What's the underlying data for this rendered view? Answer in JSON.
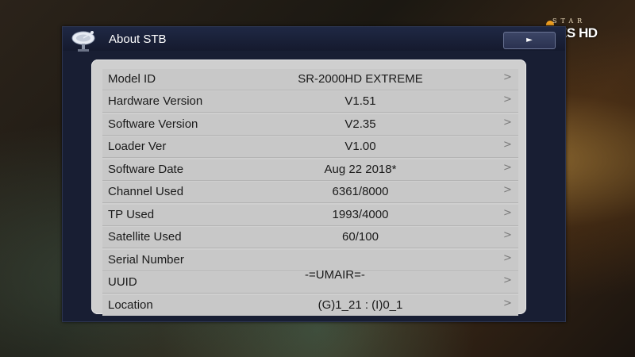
{
  "logo": {
    "star": "STAR",
    "name": "VIES HD"
  },
  "window": {
    "title": "About STB",
    "play_button": "►",
    "watermark": "-=UMAIR=-"
  },
  "rows": [
    {
      "label": "Model ID",
      "value": "SR-2000HD EXTREME",
      "arrow": ">"
    },
    {
      "label": "Hardware Version",
      "value": "V1.51",
      "arrow": ">"
    },
    {
      "label": "Software Version",
      "value": "V2.35",
      "arrow": ">"
    },
    {
      "label": "Loader Ver",
      "value": "V1.00",
      "arrow": ">"
    },
    {
      "label": "Software Date",
      "value": "Aug 22 2018*",
      "arrow": ">"
    },
    {
      "label": "Channel Used",
      "value": "6361/8000",
      "arrow": ">"
    },
    {
      "label": "TP Used",
      "value": "1993/4000",
      "arrow": ">"
    },
    {
      "label": "Satellite Used",
      "value": "60/100",
      "arrow": ">"
    },
    {
      "label": "Serial Number",
      "value": "",
      "arrow": ">"
    },
    {
      "label": "UUID",
      "value": "",
      "arrow": ">"
    },
    {
      "label": "Location",
      "value": "(G)1_21 : (I)0_1",
      "arrow": ">"
    }
  ],
  "colors": {
    "window_bg": "#181e33",
    "panel_bg": "#cfcfcf",
    "text": "#1a1a1a",
    "logo_accent": "#f0a020"
  },
  "icons": {
    "title": "satellite-dish-icon",
    "play": "play-icon"
  }
}
